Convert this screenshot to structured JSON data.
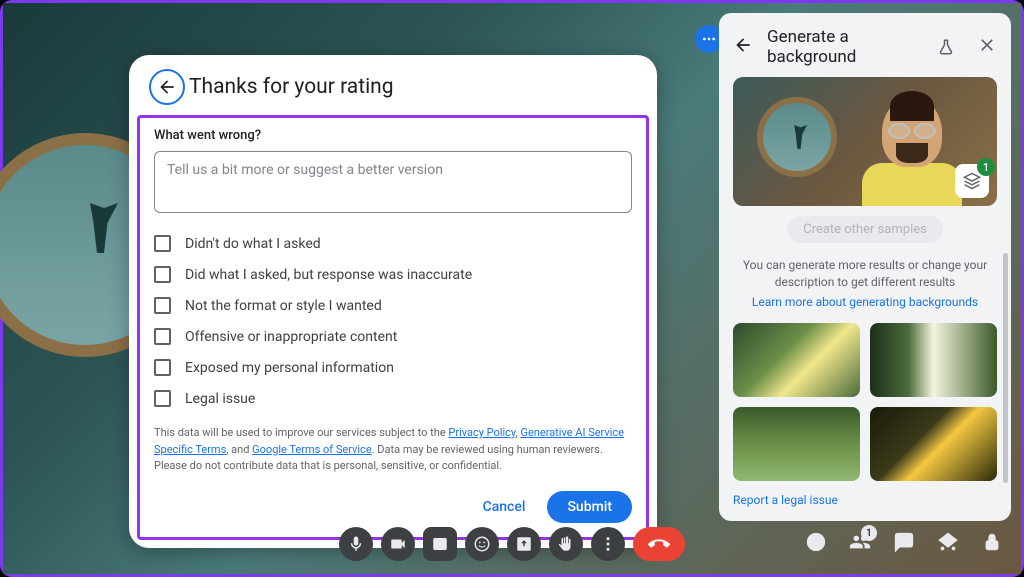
{
  "dialog": {
    "title": "Thanks for your rating",
    "section_label": "What went wrong?",
    "textarea_placeholder": "Tell us a bit more or suggest a better version",
    "options": [
      "Didn't do what I asked",
      "Did what I asked, but response was inaccurate",
      "Not the format or style I wanted",
      "Offensive or inappropriate content",
      "Exposed my personal information",
      "Legal issue"
    ],
    "disclaimer_pre": "This data will be used to improve our services subject to the ",
    "link_privacy": "Privacy Policy",
    "link_genai": "Generative AI Service Specific Terms",
    "disclaimer_and": ", and ",
    "link_tos": "Google Terms of Service",
    "disclaimer_post": ". Data may be reviewed using human reviewers. Please do not contribute data that is personal, sensitive, or confidential.",
    "cancel": "Cancel",
    "submit": "Submit"
  },
  "sidepanel": {
    "title": "Generate a background",
    "layers_count": "1",
    "create_chip": "Create other samples",
    "desc": "You can generate more results or change your description to get different results",
    "learn_link": "Learn more about generating backgrounds",
    "report_link": "Report a legal issue"
  },
  "bottombar": {
    "participants_count": "1"
  }
}
